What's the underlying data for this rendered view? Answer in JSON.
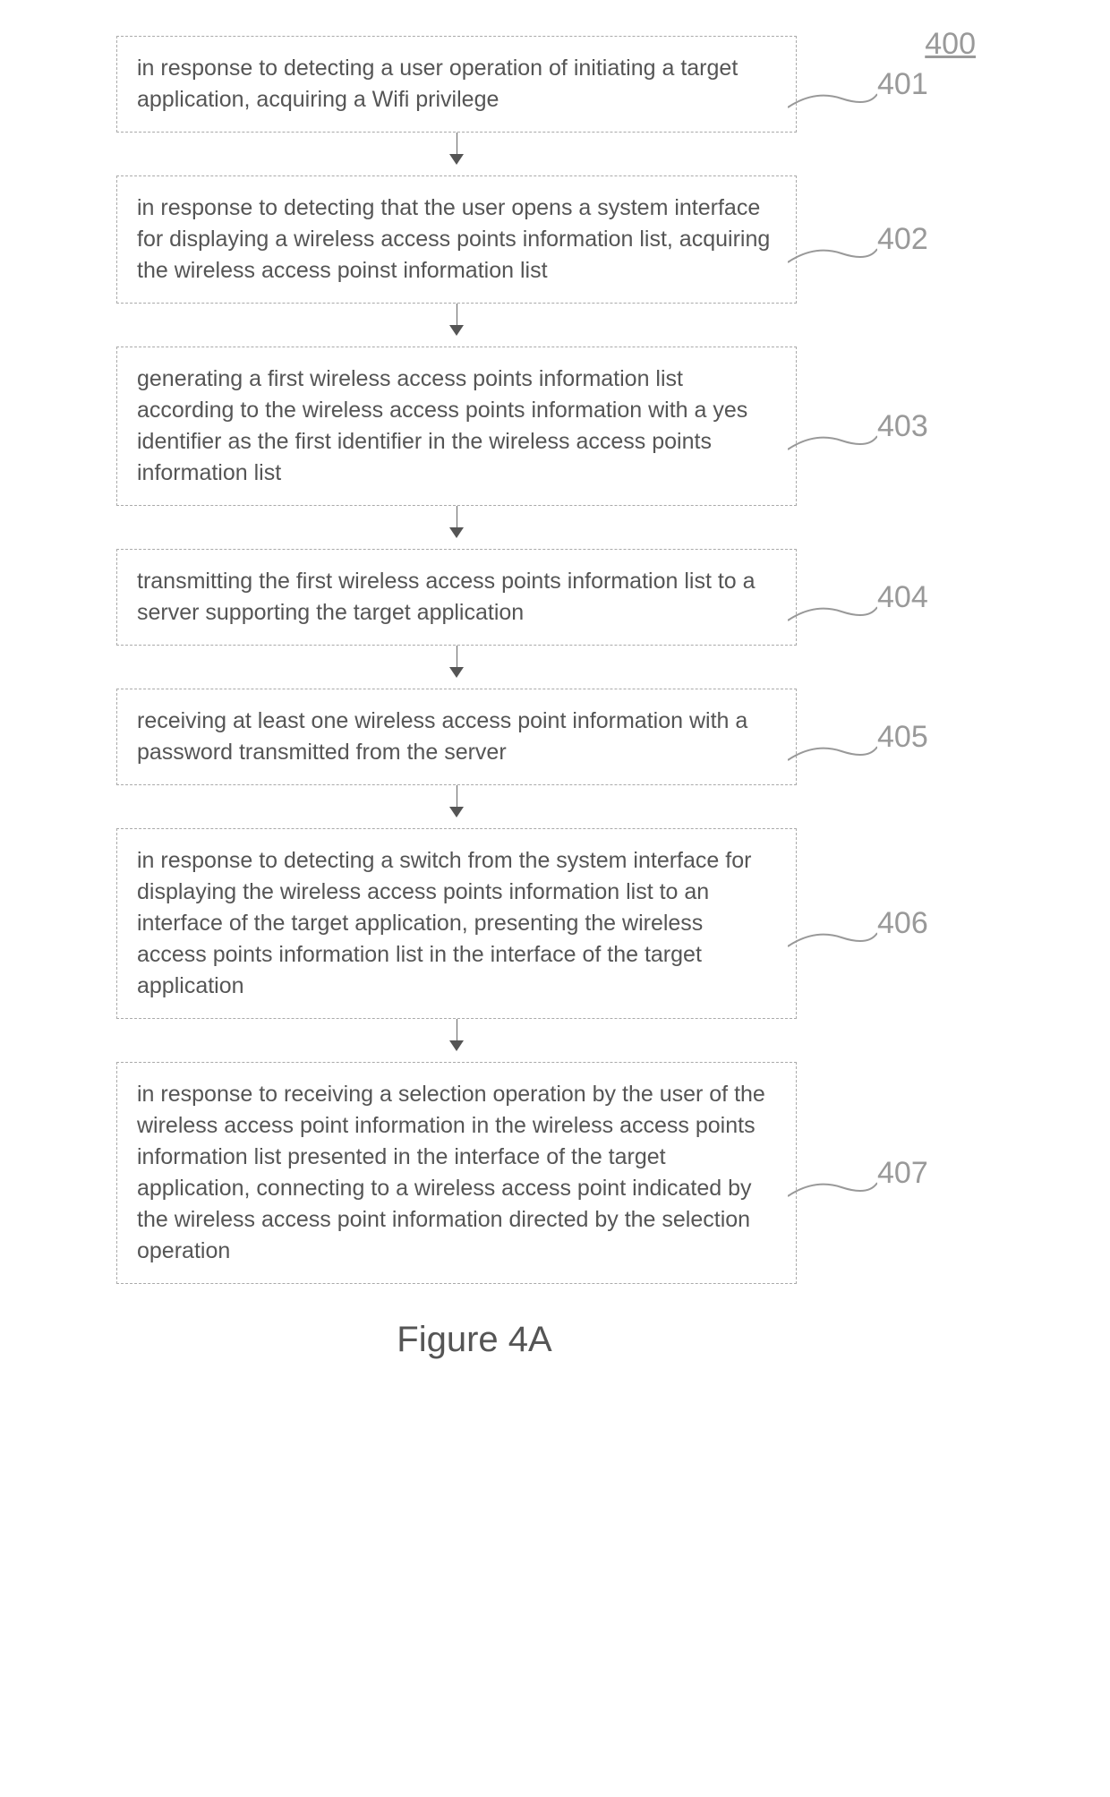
{
  "diagram_number": "400",
  "figure_caption": "Figure 4A",
  "steps": [
    {
      "label": "401",
      "text": "in response to detecting a user operation of initiating a target application, acquiring a Wifi privilege"
    },
    {
      "label": "402",
      "text": "in response to detecting that the user opens a system interface for displaying a wireless access points information list, acquiring the wireless access poinst information list"
    },
    {
      "label": "403",
      "text": "generating a first wireless access points information list according to the wireless access points information with a yes identifier as the first identifier in the wireless access points information list"
    },
    {
      "label": "404",
      "text": "transmitting the first wireless access points information list to a server supporting the target application"
    },
    {
      "label": "405",
      "text": "receiving at least one wireless access point information with a password transmitted from the server"
    },
    {
      "label": "406",
      "text": "in response to detecting a switch from the system interface for displaying the wireless access points information list to an interface of the target application, presenting the wireless access points information list in the interface of the target application"
    },
    {
      "label": "407",
      "text": "in response to receiving a selection operation by the user of the wireless access point information in the wireless access points information list presented in the interface of the target application, connecting to a wireless access point indicated by the wireless access point information directed by the selection operation"
    }
  ]
}
